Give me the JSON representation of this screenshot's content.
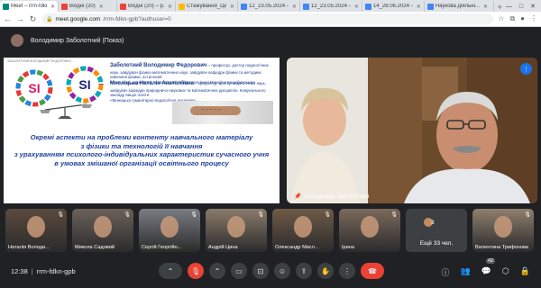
{
  "browser": {
    "tabs": [
      {
        "title": "Meet – rrm-fdkn-gpb",
        "favicon_color": "#00897b",
        "active": true
      },
      {
        "title": "Вхідні (20)",
        "favicon_color": "#ea4335",
        "active": false
      },
      {
        "title": "Вхідні (20) – p...",
        "favicon_color": "#ea4335",
        "active": false
      },
      {
        "title": "Стажування_Цен...",
        "favicon_color": "#fbbc04",
        "active": false
      },
      {
        "title": "12_23.05.2024 – ...",
        "favicon_color": "#4285f4",
        "active": false
      },
      {
        "title": "12_23.05.2024 – ...",
        "favicon_color": "#4285f4",
        "active": false
      },
      {
        "title": "14_28.06.2024 – ...",
        "favicon_color": "#4285f4",
        "active": false
      },
      {
        "title": "Наукова діяльні...",
        "favicon_color": "#4285f4",
        "active": false
      }
    ],
    "new_tab": "+",
    "url_domain": "meet.google.com",
    "url_path": "/rrm-fdkn-gpb?authuser=0"
  },
  "header": {
    "presenter": "Володимир Заболотний (Показ)"
  },
  "slide": {
    "top_text": "ЗАБОЛОТНИЙ ВОЛОДИМИР ФЕДОРОВИЧ ...",
    "author1_name": "Заболотний Володимир Федорович",
    "author1_desc": "– професор, доктор педагогічних наук, завідувач фізико-математичних наук, завідувач кафедри фізики та методики навчання фізики, астрономії",
    "author1_inst": "Вінницький державний педагогічний університет імені Михайла Коцюбинського",
    "author2_name": "Мисліцька Наталія Анатоліївна",
    "author2_desc": "– професор, доктор педагогічних наук, завідувач кафедри природничо-наукових та математичних дисциплін. Комунального закладу вищої освіти",
    "author2_inst": "«Вінницька гуманітарно-педагогічна академія»",
    "si_left": "SI",
    "si_right": "SI",
    "title_lines": [
      "Окремі аспекти на проблеми контенту навчального матеріалу",
      "з фізики та технологій її навчання",
      "з урахуванням психолого-індивідуальних характеристик сучасного учня",
      "в умовах змішаної організації освітнього процесу"
    ]
  },
  "speaker": {
    "name": "Володимир Заболотний"
  },
  "participants": [
    {
      "name": "Наталія Володи...",
      "bg": "#5a4a3e"
    },
    {
      "name": "Микола Садовий",
      "bg": "#6b6259"
    },
    {
      "name": "Сергій Георгійо...",
      "bg": "#7a7d84"
    },
    {
      "name": "Андрій Цина",
      "bg": "#8a7b6b"
    },
    {
      "name": "Олександр Мисл...",
      "bg": "#6f5b47"
    },
    {
      "name": "Ірина",
      "bg": "#7c6a5c"
    },
    {
      "name": "Валентина Трифонова",
      "bg": "#8f7f6e"
    }
  ],
  "more": {
    "count": "3",
    "label": "Ещё 33 чел."
  },
  "bottom": {
    "time": "12:38",
    "meeting_code": "rrm-fdkn-gpb",
    "people_count": "42"
  }
}
